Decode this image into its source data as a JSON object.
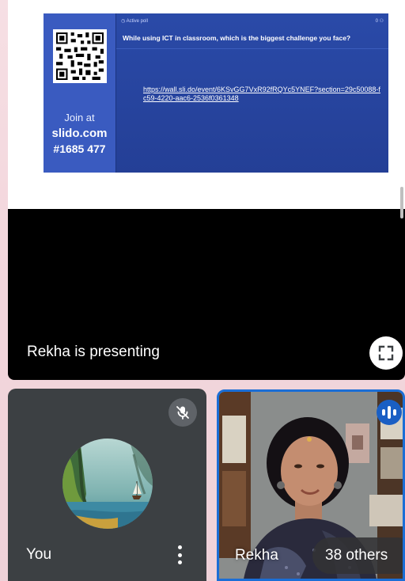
{
  "slide": {
    "poll_status": "Active poll",
    "poll_count": "0",
    "question": "While using ICT in classroom, which is the biggest challenge you face?",
    "link": "https://wall.sli.do/event/6KSvGG7VxR92fRQYc5YNEF?section=29c50088-fc59-4220-aac6-2536f0361348",
    "join_label": "Join at",
    "join_site": "slido.com",
    "join_code": "#1685 477"
  },
  "stage": {
    "presenting_text": "Rekha is presenting"
  },
  "self_tile": {
    "name": "You"
  },
  "remote_tile": {
    "name": "Rekha",
    "others": "38 others"
  },
  "colors": {
    "slido_blue": "#2c49a6",
    "active_speaker": "#1b6ed6",
    "tile_bg": "#3c4043"
  }
}
